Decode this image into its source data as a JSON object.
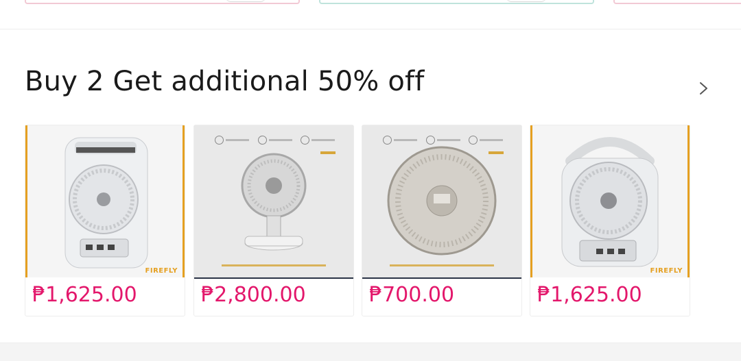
{
  "section": {
    "title": "Buy 2 Get additional 50% off"
  },
  "products": [
    {
      "price": "₱1,625.00",
      "brand": "FIREFLY",
      "icon": "rechargeable-fan-with-light"
    },
    {
      "price": "₱2,800.00",
      "brand": "",
      "icon": "desk-fan-with-lamp-base"
    },
    {
      "price": "₱700.00",
      "brand": "",
      "icon": "portable-box-fan"
    },
    {
      "price": "₱1,625.00",
      "brand": "FIREFLY",
      "icon": "rechargeable-handle-fan"
    }
  ],
  "colors": {
    "price": "#e3176b",
    "accent_orange": "#e5a021",
    "title": "#1a1a1a"
  }
}
